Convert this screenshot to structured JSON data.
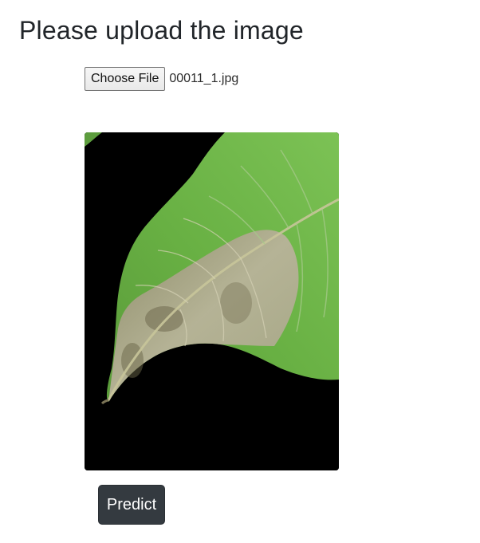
{
  "header": {
    "title": "Please upload the image"
  },
  "file_input": {
    "button_label": "Choose File",
    "selected_file": "00011_1.jpg"
  },
  "preview": {
    "icon": "leaf-photo"
  },
  "actions": {
    "predict_label": "Predict"
  },
  "colors": {
    "button_dark": "#343a40",
    "leaf_green": "#6fb84a",
    "leaf_blight": "#b3ad93",
    "photo_background": "#000000"
  }
}
